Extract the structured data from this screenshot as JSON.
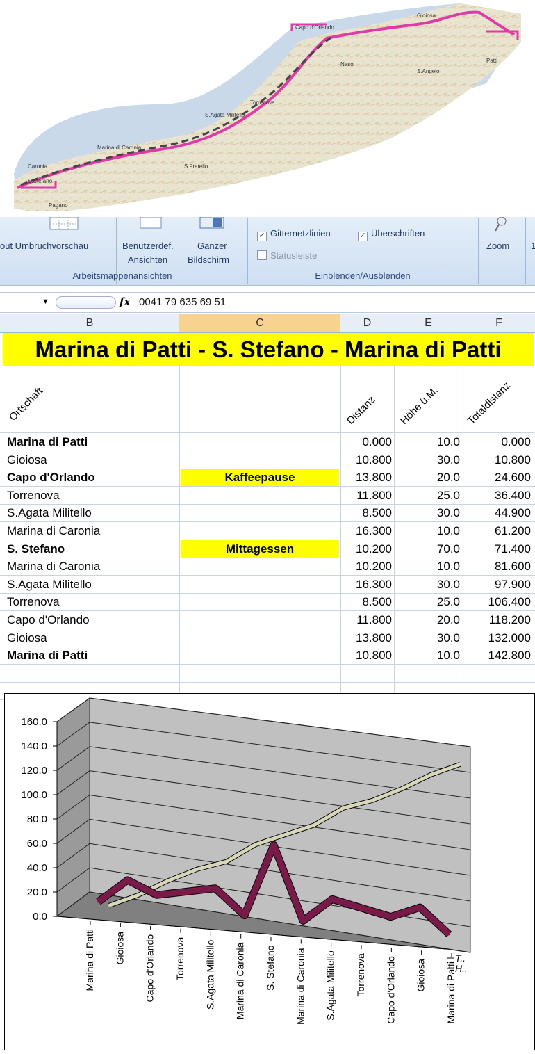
{
  "map": {
    "places": [
      "Gioiosa",
      "Capo d'Orlando",
      "S.Agata Militello",
      "Naso",
      "S.Angelo",
      "Patti",
      "Torrenova",
      "S.Fratello",
      "Marina di Caronia",
      "S.Stefano",
      "Caronia",
      "Pagano"
    ]
  },
  "ribbon": {
    "partial_left": "out Umbruchvorschau",
    "btn_custom_line1": "Benutzerdef.",
    "btn_custom_line2": "Ansichten",
    "btn_full_line1": "Ganzer",
    "btn_full_line2": "Bildschirm",
    "group_views": "Arbeitsmappenansichten",
    "chk_grid": "Gitternetzlinien",
    "chk_headers": "Überschriften",
    "chk_status": "Statusleiste",
    "group_show": "Einblenden/Ausblenden",
    "btn_zoom": "Zoom",
    "partial_right": "1"
  },
  "formula_bar": {
    "fx": "fx",
    "value": "0041 79 635 69 51"
  },
  "columns": [
    "B",
    "C",
    "D",
    "E",
    "F"
  ],
  "sheet": {
    "title": "Marina di Patti - S. Stefano - Marina di Patti",
    "headers": {
      "b": "Ortschaft",
      "d": "Distanz",
      "e": "Höhe ü.M.",
      "f": "Totaldistanz"
    },
    "rows": [
      {
        "place": "Marina di Patti",
        "note": "",
        "dist": "0.000",
        "alt": "10.0",
        "total": "0.000",
        "bold": true
      },
      {
        "place": "Gioiosa",
        "note": "",
        "dist": "10.800",
        "alt": "30.0",
        "total": "10.800",
        "bold": false
      },
      {
        "place": "Capo d'Orlando",
        "note": "Kaffeepause",
        "dist": "13.800",
        "alt": "20.0",
        "total": "24.600",
        "bold": true
      },
      {
        "place": "Torrenova",
        "note": "",
        "dist": "11.800",
        "alt": "25.0",
        "total": "36.400",
        "bold": false
      },
      {
        "place": "S.Agata Militello",
        "note": "",
        "dist": "8.500",
        "alt": "30.0",
        "total": "44.900",
        "bold": false
      },
      {
        "place": "Marina di Caronia",
        "note": "",
        "dist": "16.300",
        "alt": "10.0",
        "total": "61.200",
        "bold": false
      },
      {
        "place": "S. Stefano",
        "note": "Mittagessen",
        "dist": "10.200",
        "alt": "70.0",
        "total": "71.400",
        "bold": true
      },
      {
        "place": "Marina di Caronia",
        "note": "",
        "dist": "10.200",
        "alt": "10.0",
        "total": "81.600",
        "bold": false
      },
      {
        "place": "S.Agata Militello",
        "note": "",
        "dist": "16.300",
        "alt": "30.0",
        "total": "97.900",
        "bold": false
      },
      {
        "place": "Torrenova",
        "note": "",
        "dist": "8.500",
        "alt": "25.0",
        "total": "106.400",
        "bold": false
      },
      {
        "place": "Capo d'Orlando",
        "note": "",
        "dist": "11.800",
        "alt": "20.0",
        "total": "118.200",
        "bold": false
      },
      {
        "place": "Gioiosa",
        "note": "",
        "dist": "13.800",
        "alt": "30.0",
        "total": "132.000",
        "bold": false
      },
      {
        "place": "Marina di Patti",
        "note": "",
        "dist": "10.800",
        "alt": "10.0",
        "total": "142.800",
        "bold": true
      }
    ]
  },
  "chart_data": {
    "type": "line",
    "categories": [
      "Marina di Patti",
      "Gioiosa",
      "Capo d'Orlando",
      "Torrenova",
      "S.Agata Militello",
      "Marina di Caronia",
      "S. Stefano",
      "Marina di Caronia",
      "S.Agata Militello",
      "Torrenova",
      "Capo d'Orlando",
      "Gioiosa",
      "Marina di Patti"
    ],
    "series": [
      {
        "name": "T..",
        "values": [
          0.0,
          10.8,
          24.6,
          36.4,
          44.9,
          61.2,
          71.4,
          81.6,
          97.9,
          106.4,
          118.2,
          132.0,
          142.8
        ],
        "color": "#d8d8b8"
      },
      {
        "name": "H..",
        "values": [
          10.0,
          30.0,
          20.0,
          25.0,
          30.0,
          10.0,
          70.0,
          10.0,
          30.0,
          25.0,
          20.0,
          30.0,
          10.0
        ],
        "color": "#7a1a48"
      }
    ],
    "yticks": [
      "160.0",
      "140.0",
      "120.0",
      "100.0",
      "80.0",
      "60.0",
      "40.0",
      "20.0",
      "0.0"
    ],
    "ylim": [
      0,
      160
    ],
    "grid": true,
    "legend": "right"
  }
}
